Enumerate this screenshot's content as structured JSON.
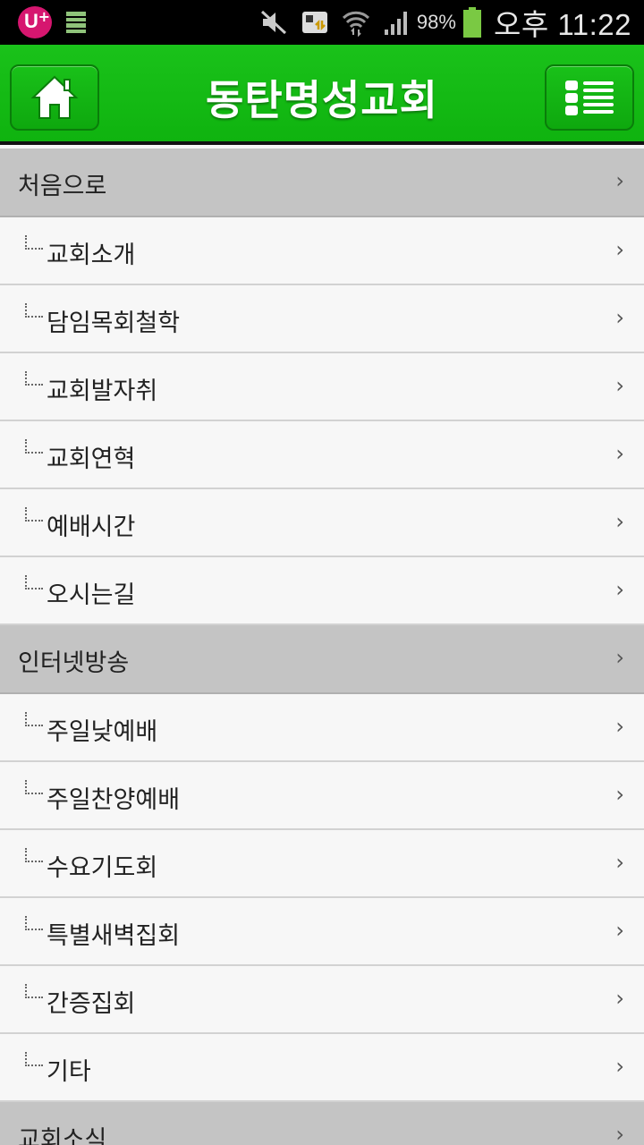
{
  "status_bar": {
    "carrier_icon": "uplus-icon",
    "battery_percent": "98%",
    "time": "오후 11:22"
  },
  "header": {
    "title": "동탄명성교회",
    "home_icon": "home-icon",
    "menu_icon": "list-menu-icon",
    "accent_color": "#12b812"
  },
  "menu": [
    {
      "type": "section",
      "label": "처음으로"
    },
    {
      "type": "item",
      "label": "교회소개"
    },
    {
      "type": "item",
      "label": "담임목회철학"
    },
    {
      "type": "item",
      "label": "교회발자취"
    },
    {
      "type": "item",
      "label": "교회연혁"
    },
    {
      "type": "item",
      "label": "예배시간"
    },
    {
      "type": "item",
      "label": "오시는길"
    },
    {
      "type": "section",
      "label": "인터넷방송"
    },
    {
      "type": "item",
      "label": "주일낮예배"
    },
    {
      "type": "item",
      "label": "주일찬양예배"
    },
    {
      "type": "item",
      "label": "수요기도회"
    },
    {
      "type": "item",
      "label": "특별새벽집회"
    },
    {
      "type": "item",
      "label": "간증집회"
    },
    {
      "type": "item",
      "label": "기타"
    },
    {
      "type": "section",
      "label": "교회소식"
    }
  ],
  "chevron": "›"
}
